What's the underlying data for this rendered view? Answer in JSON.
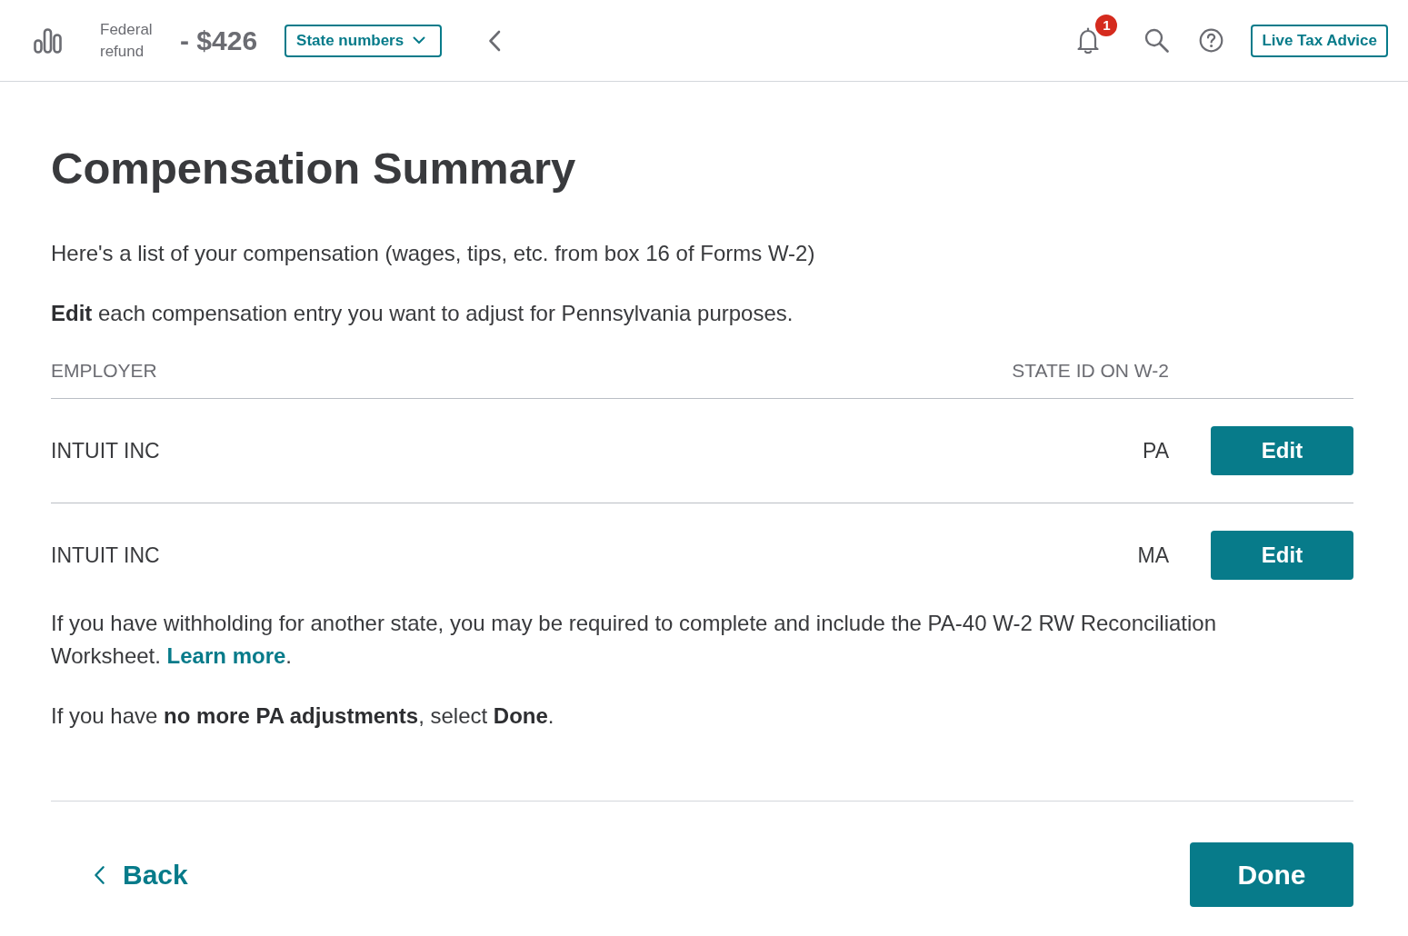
{
  "header": {
    "federal_refund": {
      "label": "Federal refund",
      "amount": "- $426"
    },
    "state_numbers_button": {
      "label": "State numbers"
    },
    "notifications": {
      "badge": "1"
    },
    "live_tax_advice_button": {
      "label": "Live Tax Advice"
    }
  },
  "page": {
    "title": "Compensation Summary",
    "intro": "Here's a list of your compensation (wages, tips, etc. from box 16 of Forms W-2)",
    "instruction": "**Edit** each compensation entry you want to adjust for Pennsylvania purposes.",
    "table": {
      "columns": [
        "EMPLOYER",
        "STATE ID ON W-2"
      ],
      "rows": [
        {
          "employer": "INTUIT INC",
          "state_id": "PA",
          "action": "Edit"
        },
        {
          "employer": "INTUIT INC",
          "state_id": "MA",
          "action": "Edit"
        }
      ]
    },
    "note": {
      "text": "If you have withholding for another state, you may be required to complete and include the PA-40 W-2 RW Reconciliation Worksheet.",
      "link": "Learn more",
      "after": "."
    },
    "closing": "If you have **no more PA adjustments**, select **Done**."
  },
  "footer": {
    "back_button": "Back",
    "done_button": "Done"
  }
}
